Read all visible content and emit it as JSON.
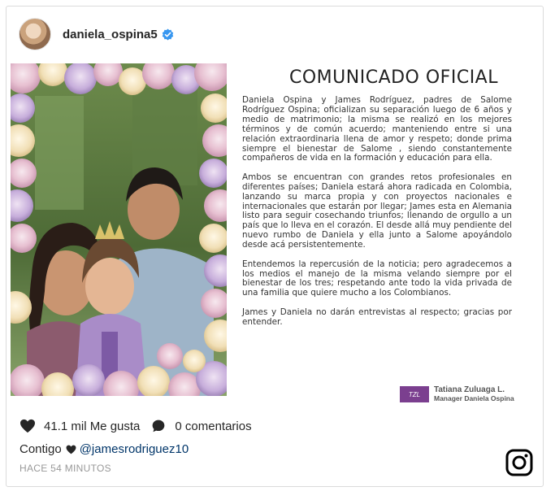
{
  "post": {
    "username": "daniela_ospina5",
    "verified": true,
    "avatar_icon": "profile-avatar"
  },
  "document": {
    "title": "COMUNICADO OFICIAL",
    "paragraphs": [
      "Daniela Ospina y James Rodríguez, padres de Salome Rodríguez Ospina; oficializan su separación luego de 6 años y medio de matrimonio; la misma se realizó en los mejores términos y de común acuerdo; manteniendo entre si una relación extraordinaria llena de amor y respeto; donde prima siempre el bienestar de Salome , siendo constantemente compañeros de vida en la formación y educación para ella.",
      "Ambos se encuentran con grandes retos profesionales en diferentes países; Daniela estará ahora radicada en Colombia, lanzando su marca propia y con proyectos nacionales e internacionales que estarán por llegar; James esta en Alemania listo para seguir cosechando triunfos; llenando de orgullo a un país que lo lleva en el corazón. El desde allá muy pendiente del nuevo rumbo de Daniela y ella junto a Salome apoyándolo desde acá persistentemente.",
      "Entendemos la repercusión de la noticia; pero agradecemos a los medios el manejo de la misma velando siempre por el bienestar de los tres; respetando ante todo la vida privada de una familia que quiere mucho a los Colombianos.",
      "James y Daniela no darán entrevistas al respecto; gracias por entender."
    ],
    "signature": {
      "logo_text": "TZL",
      "name": "Tatiana Zuluaga L.",
      "role": "Manager Daniela Ospina"
    }
  },
  "actions": {
    "likes": "41.1 mil Me gusta",
    "comments": "0 comentarios"
  },
  "caption": {
    "text": "Contigo",
    "mention": "@jamesrodriguez10"
  },
  "timestamp": "HACE 54 MINUTOS",
  "colors": {
    "border": "#dbdbdb",
    "verified_blue": "#3897f0",
    "mention": "#003569",
    "muted": "#999999",
    "logo_purple": "#7b3f8f"
  }
}
